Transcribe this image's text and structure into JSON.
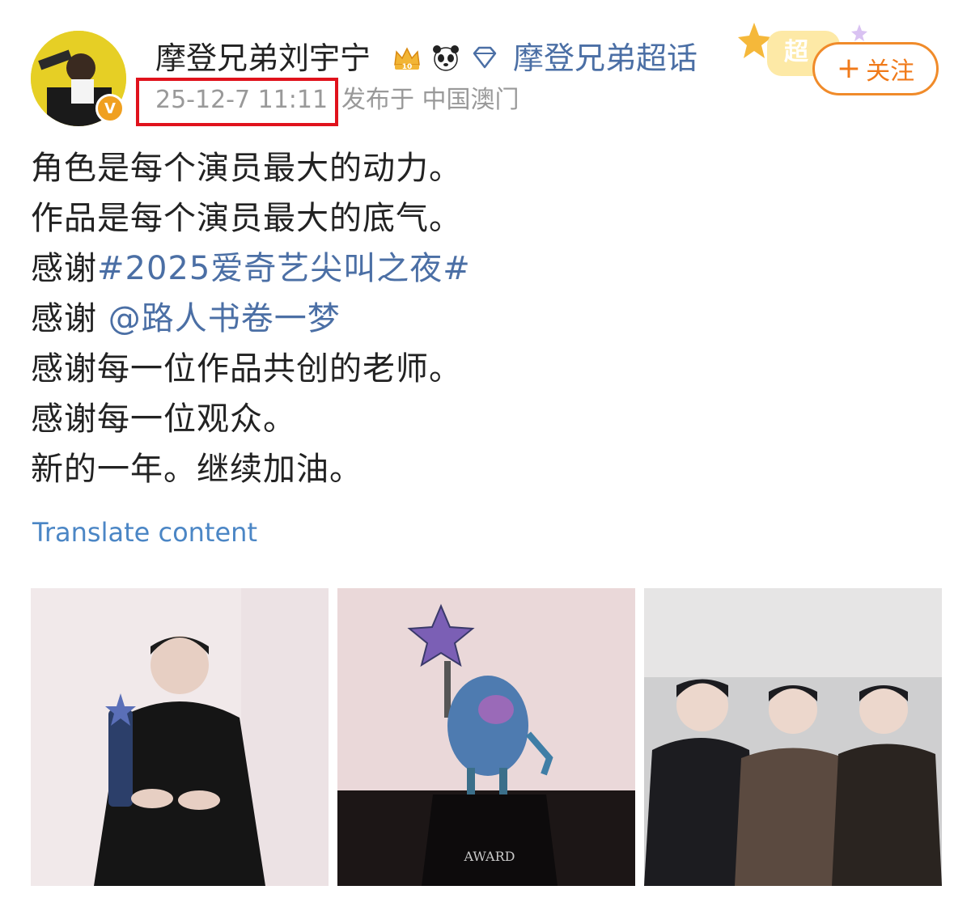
{
  "post": {
    "user_name": "摩登兄弟刘宇宁",
    "super_topic": "摩登兄弟超话",
    "timestamp": "25-12-7 11:11",
    "location": "发布于 中国澳门",
    "follow_label": "关注",
    "super_label": "超",
    "crown_level": "10",
    "lines": [
      {
        "text": "角色是每个演员最大的动力。"
      },
      {
        "text": "作品是每个演员最大的底气。"
      },
      {
        "prefix": "感谢",
        "link": "#2025爱奇艺尖叫之夜#"
      },
      {
        "prefix": "感谢 ",
        "link": "@路人书卷一梦"
      },
      {
        "text": "感谢每一位作品共创的老师。"
      },
      {
        "text": "感谢每一位观众。"
      },
      {
        "text": "新的一年。继续加油。"
      }
    ],
    "translate_label": "Translate content",
    "award_label": "AWARD"
  },
  "icons": {
    "verified": "verified-v-icon",
    "crown": "crown-level-icon",
    "panda": "panda-icon",
    "diamond": "diamond-icon",
    "plus": "plus-icon"
  },
  "colors": {
    "link": "#4b6fa5",
    "timestamp": "#999999",
    "follow": "#f07a1a",
    "highlight_box": "#e0121c"
  }
}
